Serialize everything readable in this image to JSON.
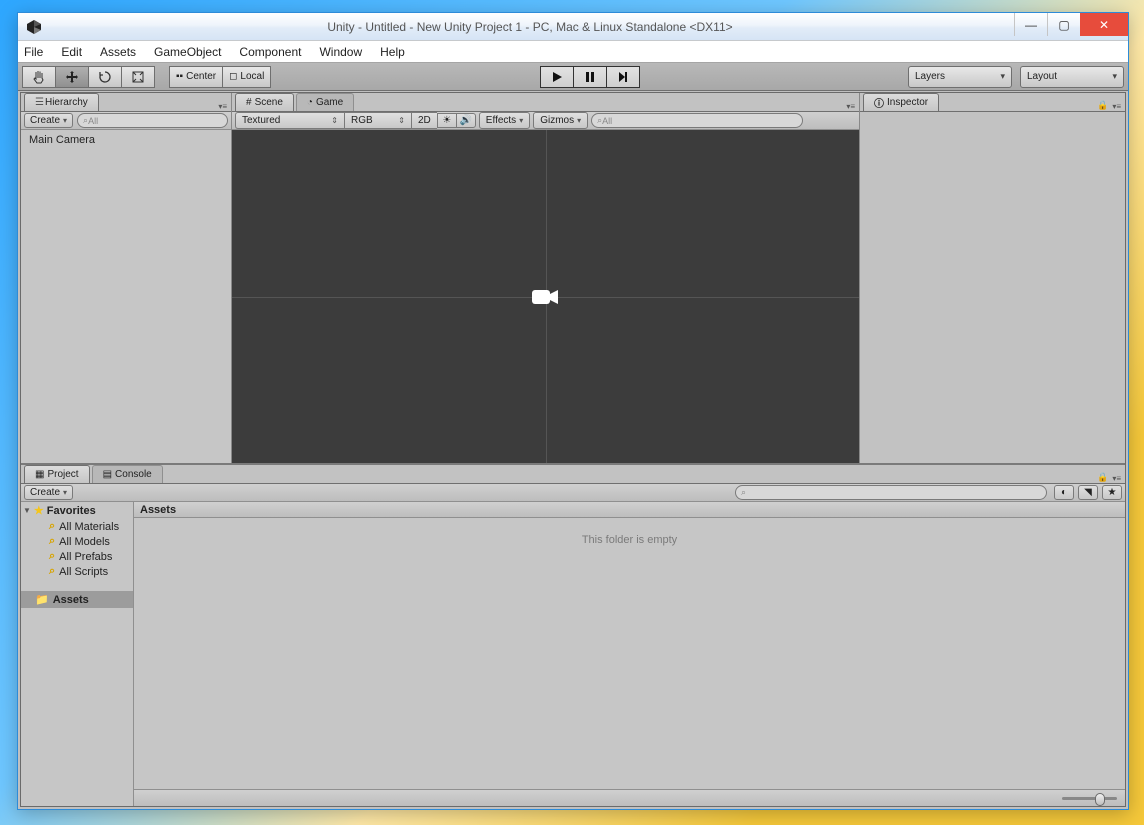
{
  "window": {
    "title": "Unity - Untitled - New Unity Project 1 - PC, Mac & Linux Standalone <DX11>"
  },
  "menus": [
    "File",
    "Edit",
    "Assets",
    "GameObject",
    "Component",
    "Window",
    "Help"
  ],
  "toolbar": {
    "pivot": "Center",
    "space": "Local",
    "layers_label": "Layers",
    "layout_label": "Layout"
  },
  "hierarchy": {
    "tab": "Hierarchy",
    "create": "Create",
    "search_placeholder": "All",
    "items": [
      "Main Camera"
    ]
  },
  "scene": {
    "tab_scene": "Scene",
    "tab_game": "Game",
    "shading": "Textured",
    "render_mode": "RGB",
    "mode_2d": "2D",
    "effects": "Effects",
    "gizmos": "Gizmos",
    "search_placeholder": "All"
  },
  "inspector": {
    "tab": "Inspector"
  },
  "project": {
    "tab_project": "Project",
    "tab_console": "Console",
    "create": "Create",
    "favorites_label": "Favorites",
    "favorites": [
      "All Materials",
      "All Models",
      "All Prefabs",
      "All Scripts"
    ],
    "assets_label": "Assets",
    "breadcrumb": "Assets",
    "empty_text": "This folder is empty"
  }
}
